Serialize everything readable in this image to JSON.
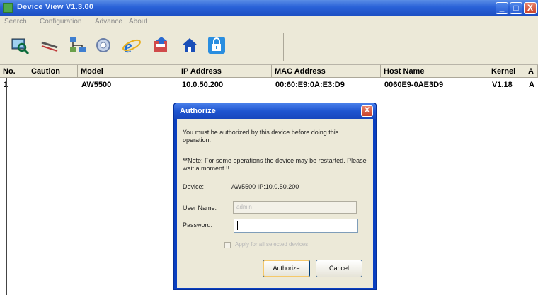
{
  "window": {
    "title": "Device View V1.3.00",
    "controls": [
      "_",
      "□",
      "X"
    ]
  },
  "menu": {
    "items": [
      "Search",
      "Configuration",
      "Advance",
      "About"
    ]
  },
  "toolbar": {
    "icons": [
      "search-device-icon",
      "cable-icon",
      "network-icon",
      "settings-icon",
      "internet-explorer-icon",
      "firmware-upload-icon",
      "home-icon",
      "lock-icon"
    ]
  },
  "table": {
    "headers": [
      "No.",
      "Caution",
      "Model",
      "IP Address",
      "MAC Address",
      "Host Name",
      "Kernel",
      "A"
    ],
    "rows": [
      {
        "no": "1",
        "caution": "",
        "model": "AW5500",
        "ip": "10.0.50.200",
        "mac": "00:60:E9:0A:E3:D9",
        "host": "0060E9-0AE3D9",
        "kernel": "V1.18",
        "extra": "A"
      }
    ]
  },
  "dialog": {
    "title": "Authorize",
    "close": "X",
    "message": "You must be authorized by this device before doing this operation.",
    "note": "**Note: For some operations the device may be restarted. Please wait a moment !!",
    "device_label": "Device:",
    "device_value": "AW5500  IP:10.0.50.200",
    "user_label": "User Name:",
    "user_value": "admin",
    "password_label": "Password:",
    "password_value": "",
    "apply_all_label": "Apply for all selected devices",
    "authorize_label": "Authorize",
    "cancel_label": "Cancel"
  }
}
